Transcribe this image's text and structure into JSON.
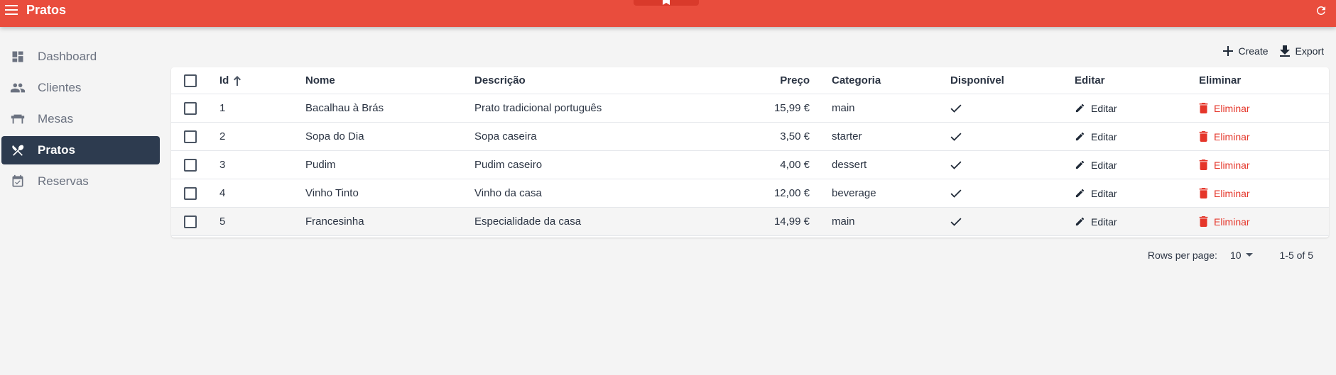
{
  "app": {
    "title": "Pratos",
    "accent": "#e94d3d",
    "sidebar_active_bg": "#2d3b4f",
    "danger": "#e5362a"
  },
  "sidebar": {
    "items": [
      {
        "label": "Dashboard",
        "icon": "dashboard-icon"
      },
      {
        "label": "Clientes",
        "icon": "people-icon"
      },
      {
        "label": "Mesas",
        "icon": "table-icon"
      },
      {
        "label": "Pratos",
        "icon": "restaurant-icon",
        "active": true
      },
      {
        "label": "Reservas",
        "icon": "calendar-check-icon"
      }
    ]
  },
  "toolbar": {
    "create_label": "Create",
    "export_label": "Export"
  },
  "table": {
    "columns": {
      "id": "Id",
      "nome": "Nome",
      "descricao": "Descrição",
      "preco": "Preço",
      "categoria": "Categoria",
      "disponivel": "Disponível",
      "editar": "Editar",
      "eliminar": "Eliminar"
    },
    "sort": {
      "column": "Id",
      "direction": "ascending"
    },
    "rows": [
      {
        "id": "1",
        "nome": "Bacalhau à Brás",
        "descricao": "Prato tradicional português",
        "preco": "15,99 €",
        "categoria": "main",
        "disponivel": true,
        "edit_label": "Editar",
        "delete_label": "Eliminar"
      },
      {
        "id": "2",
        "nome": "Sopa do Dia",
        "descricao": "Sopa caseira",
        "preco": "3,50 €",
        "categoria": "starter",
        "disponivel": true,
        "edit_label": "Editar",
        "delete_label": "Eliminar"
      },
      {
        "id": "3",
        "nome": "Pudim",
        "descricao": "Pudim caseiro",
        "preco": "4,00 €",
        "categoria": "dessert",
        "disponivel": true,
        "edit_label": "Editar",
        "delete_label": "Eliminar"
      },
      {
        "id": "4",
        "nome": "Vinho Tinto",
        "descricao": "Vinho da casa",
        "preco": "12,00 €",
        "categoria": "beverage",
        "disponivel": true,
        "edit_label": "Editar",
        "delete_label": "Eliminar"
      },
      {
        "id": "5",
        "nome": "Francesinha",
        "descricao": "Especialidade da casa",
        "preco": "14,99 €",
        "categoria": "main",
        "disponivel": true,
        "edit_label": "Editar",
        "delete_label": "Eliminar"
      }
    ]
  },
  "pagination": {
    "rows_per_page_label": "Rows per page:",
    "rows_per_page_value": "10",
    "range_label": "1-5 of 5"
  }
}
